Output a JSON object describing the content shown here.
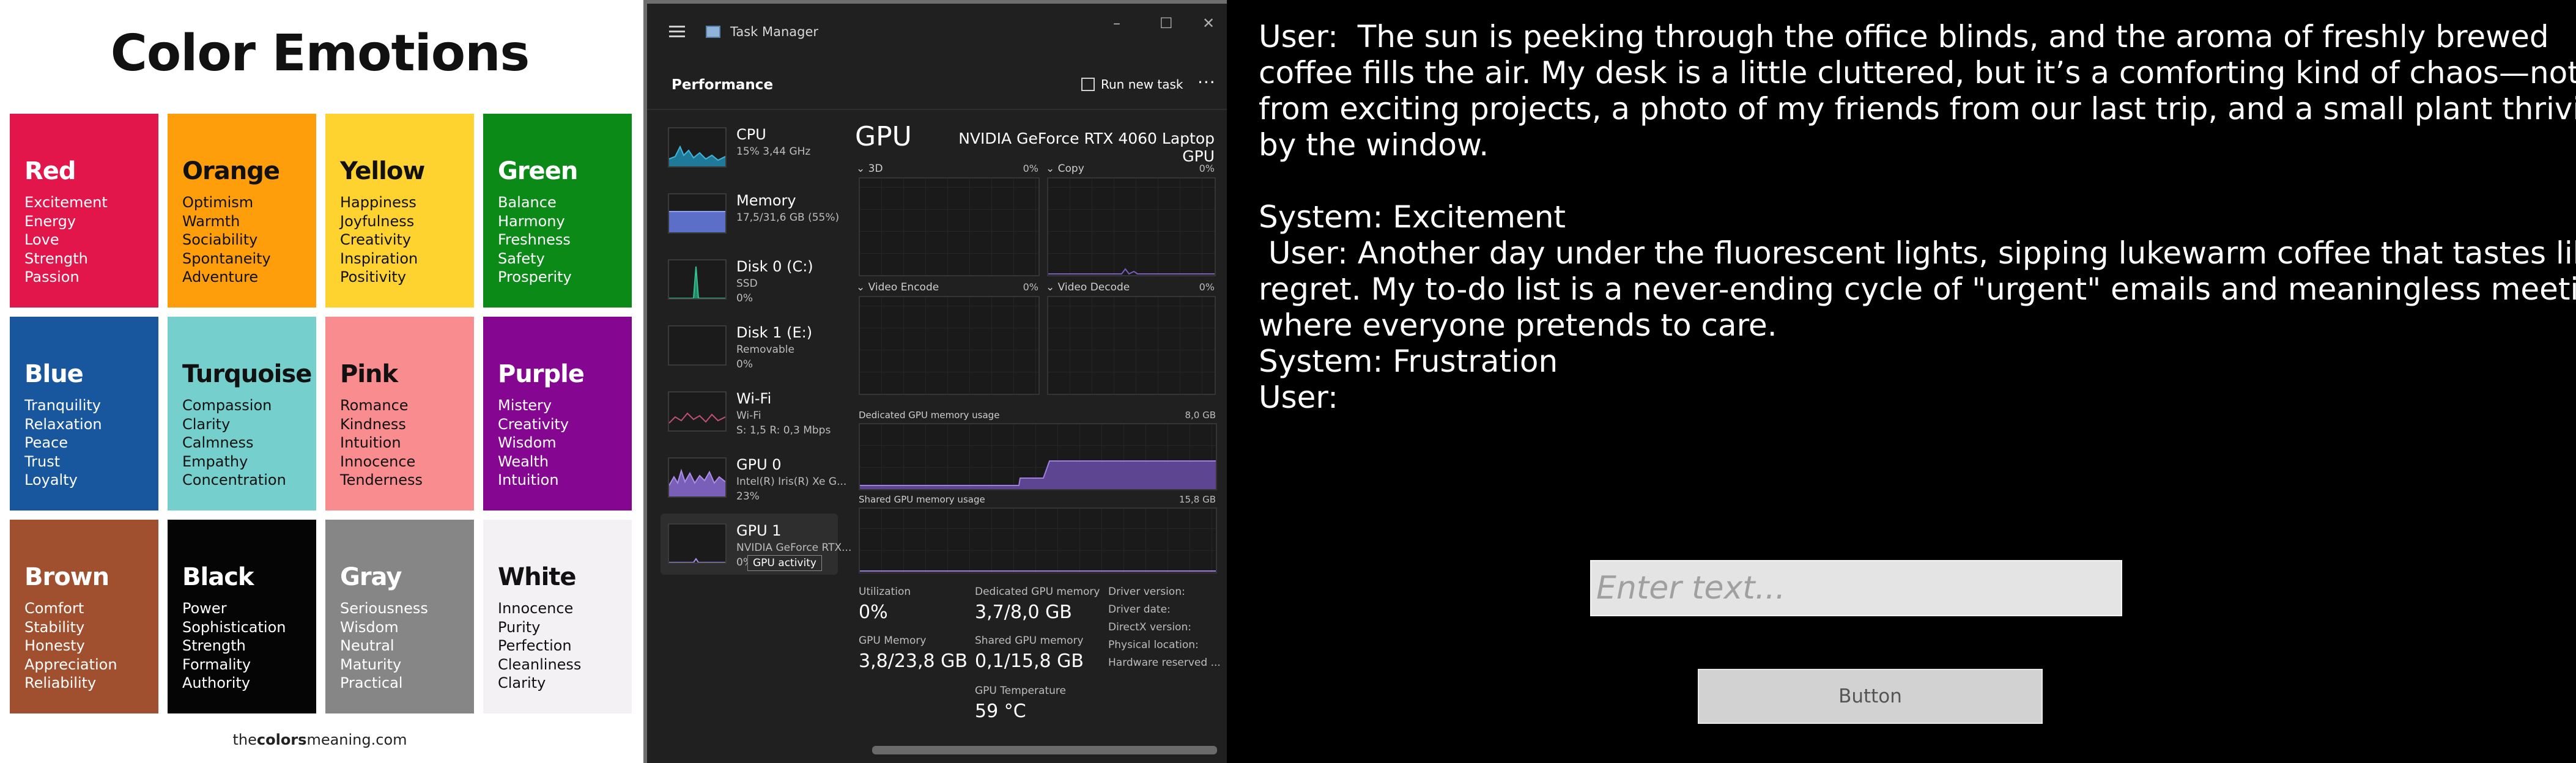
{
  "color_emotions": {
    "title": "Color Emotions",
    "footer_prefix": "the",
    "footer_brand": "colors",
    "footer_suffix": "meaning.com",
    "tiles": [
      {
        "name": "Red",
        "bg": "#e2164a",
        "fg": "#ffffff",
        "words": [
          "Excitement",
          "Energy",
          "Love",
          "Strength",
          "Passion"
        ]
      },
      {
        "name": "Orange",
        "bg": "#fe9e0b",
        "fg": "#111111",
        "words": [
          "Optimism",
          "Warmth",
          "Sociability",
          "Spontaneity",
          "Adventure"
        ]
      },
      {
        "name": "Yellow",
        "bg": "#fed22f",
        "fg": "#111111",
        "words": [
          "Happiness",
          "Joyfulness",
          "Creativity",
          "Inspiration",
          "Positivity"
        ]
      },
      {
        "name": "Green",
        "bg": "#0b8a18",
        "fg": "#ffffff",
        "words": [
          "Balance",
          "Harmony",
          "Freshness",
          "Safety",
          "Prosperity"
        ]
      },
      {
        "name": "Blue",
        "bg": "#18569e",
        "fg": "#ffffff",
        "words": [
          "Tranquility",
          "Relaxation",
          "Peace",
          "Trust",
          "Loyalty"
        ]
      },
      {
        "name": "Turquoise",
        "bg": "#74cfcd",
        "fg": "#111111",
        "words": [
          "Compassion",
          "Clarity",
          "Calmness",
          "Empathy",
          "Concentration"
        ]
      },
      {
        "name": "Pink",
        "bg": "#f88c8f",
        "fg": "#111111",
        "words": [
          "Romance",
          "Kindness",
          "Intuition",
          "Innocence",
          "Tenderness"
        ]
      },
      {
        "name": "Purple",
        "bg": "#850791",
        "fg": "#ffffff",
        "words": [
          "Mistery",
          "Creativity",
          "Wisdom",
          "Wealth",
          "Intuition"
        ]
      },
      {
        "name": "Brown",
        "bg": "#a0502f",
        "fg": "#ffffff",
        "words": [
          "Comfort",
          "Stability",
          "Honesty",
          "Appreciation",
          "Reliability"
        ]
      },
      {
        "name": "Black",
        "bg": "#050505",
        "fg": "#ffffff",
        "words": [
          "Power",
          "Sophistication",
          "Strength",
          "Formality",
          "Authority"
        ]
      },
      {
        "name": "Gray",
        "bg": "#868686",
        "fg": "#ffffff",
        "words": [
          "Seriousness",
          "Wisdom",
          "Neutral",
          "Maturity",
          "Practical"
        ]
      },
      {
        "name": "White",
        "bg": "#f4f1f5",
        "fg": "#111111",
        "words": [
          "Innocence",
          "Purity",
          "Perfection",
          "Cleanliness",
          "Clarity"
        ]
      }
    ]
  },
  "task_manager": {
    "window_title": "Task Manager",
    "minimize": "–",
    "maximize": "☐",
    "close": "✕",
    "section": "Performance",
    "run_new_task": "Run new task",
    "more": "···",
    "sidebar": [
      {
        "l1": "CPU",
        "l2": "15% 3,44 GHz",
        "l3": ""
      },
      {
        "l1": "Memory",
        "l2": "17,5/31,6 GB (55%)",
        "l3": ""
      },
      {
        "l1": "Disk 0 (C:)",
        "l2": "SSD",
        "l3": "0%"
      },
      {
        "l1": "Disk 1 (E:)",
        "l2": "Removable",
        "l3": "0%"
      },
      {
        "l1": "Wi-Fi",
        "l2": "Wi-Fi",
        "l3": "S: 1,5 R: 0,3 Mbps"
      },
      {
        "l1": "GPU 0",
        "l2": "Intel(R) Iris(R) Xe G...",
        "l3": "23%"
      },
      {
        "l1": "GPU 1",
        "l2": "NVIDIA GeForce RTX...",
        "l3": "0% (59 °C)"
      }
    ],
    "tooltip": "GPU activity",
    "gpu_title": "GPU",
    "gpu_model": "NVIDIA GeForce RTX 4060 Laptop GPU",
    "engines": [
      {
        "label": "3D",
        "pct": "0%"
      },
      {
        "label": "Copy",
        "pct": "0%"
      },
      {
        "label": "Video Encode",
        "pct": "0%"
      },
      {
        "label": "Video Decode",
        "pct": "0%"
      }
    ],
    "dedicated_label": "Dedicated GPU memory usage",
    "dedicated_max": "8,0 GB",
    "shared_label": "Shared GPU memory usage",
    "shared_max": "15,8 GB",
    "stats": {
      "utilization_label": "Utilization",
      "utilization": "0%",
      "dedicated_label": "Dedicated GPU memory",
      "dedicated": "3,7/8,0 GB",
      "gpu_memory_label": "GPU Memory",
      "gpu_memory": "3,8/23,8 GB",
      "shared_label": "Shared GPU memory",
      "shared": "0,1/15,8 GB",
      "temp_label": "GPU Temperature",
      "temp": "59 °C"
    },
    "driver": [
      "Driver version:",
      "Driver date:",
      "DirectX version:",
      "Physical location:",
      "Hardware reserved ..."
    ],
    "accent": "#7b5cc0"
  },
  "chat": {
    "lines": [
      "User:  The sun is peeking through the office blinds, and the aroma of freshly brewed",
      "coffee fills the air. My desk is a little cluttered, but it’s a comforting kind of chaos—notes",
      "from exciting projects, a photo of my friends from our last trip, and a small plant thriving",
      "by the window.",
      "",
      "System: Excitement",
      " User: Another day under the fluorescent lights, sipping lukewarm coffee that tastes like",
      "regret. My to-do list is a never-ending cycle of \"urgent\" emails and meaningless meetings",
      "where everyone pretends to care.",
      "System: Frustration",
      "User:"
    ],
    "input_placeholder": "Enter text...",
    "input_value": "",
    "button_label": "Button"
  }
}
